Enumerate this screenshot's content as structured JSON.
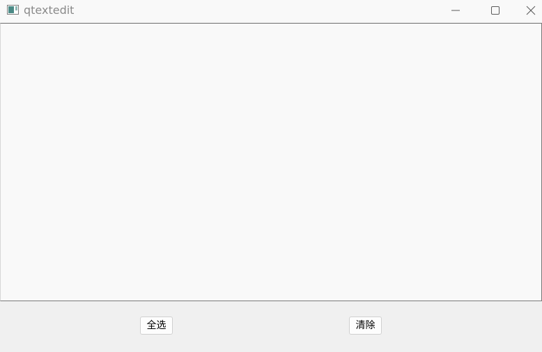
{
  "window": {
    "title": "qtextedit",
    "icon": "app-window-icon"
  },
  "title_controls": {
    "minimize_icon": "minimize-icon",
    "maximize_icon": "maximize-icon",
    "close_icon": "close-icon"
  },
  "editor": {
    "value": ""
  },
  "buttons": {
    "select_all_label": "全选",
    "clear_label": "清除"
  },
  "colors": {
    "titlebar_bg": "#f9f9f9",
    "editor_bg": "#f9f9f9",
    "window_bg": "#f0f0f0",
    "button_bg": "#fdfdfd"
  }
}
